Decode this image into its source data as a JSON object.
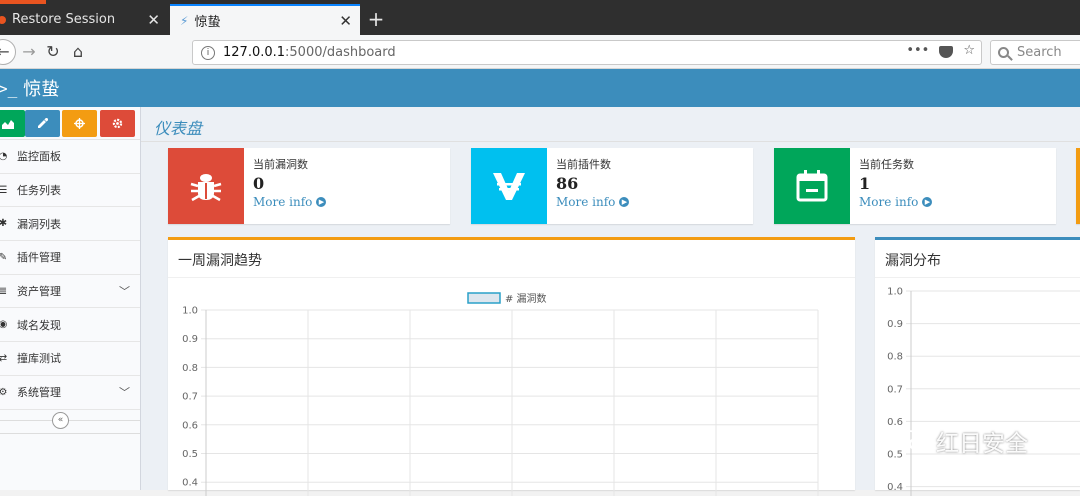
{
  "browser": {
    "tabs": [
      {
        "label": "Restore Session",
        "active": false
      },
      {
        "label": "惊蛰",
        "active": true
      }
    ],
    "url_host": "127.0.0.1",
    "url_path": ":5000/dashboard",
    "search_placeholder": "Search",
    "accent_color": "#0a84ff"
  },
  "app": {
    "title": "惊蛰",
    "header_color": "#3c8dbc"
  },
  "sidebar": {
    "buttons": [
      {
        "icon": "chart-icon",
        "color": "#00a65a"
      },
      {
        "icon": "pencil-icon",
        "color": "#3c8dbc"
      },
      {
        "icon": "crosshair-icon",
        "color": "#f39c12"
      },
      {
        "icon": "gear-icon",
        "color": "#dd4b39"
      }
    ],
    "items": [
      {
        "label": "监控面板",
        "icon": "dashboard-icon"
      },
      {
        "label": "任务列表",
        "icon": "list-icon"
      },
      {
        "label": "漏洞列表",
        "icon": "bug-icon"
      },
      {
        "label": "插件管理",
        "icon": "edit-icon"
      },
      {
        "label": "资产管理",
        "icon": "database-icon",
        "has_submenu": true
      },
      {
        "label": "域名发现",
        "icon": "eye-icon"
      },
      {
        "label": "撞库测试",
        "icon": "shuffle-icon"
      },
      {
        "label": "系统管理",
        "icon": "cogs-icon",
        "has_submenu": true
      }
    ]
  },
  "page": {
    "title": "仪表盘"
  },
  "info_boxes": [
    {
      "label": "当前漏洞数",
      "value": "0",
      "more": "More info",
      "color": "#dd4b39",
      "icon": "bug-icon"
    },
    {
      "label": "当前插件数",
      "value": "86",
      "more": "More info",
      "color": "#00c0ef",
      "icon": "vechain-icon"
    },
    {
      "label": "当前任务数",
      "value": "1",
      "more": "More info",
      "color": "#00a65a",
      "icon": "calendar-icon"
    }
  ],
  "panels": {
    "weekly": {
      "title": "一周漏洞趋势",
      "accent": "#f39c12"
    },
    "distribution": {
      "title": "漏洞分布",
      "accent": "#3c8dbc"
    }
  },
  "chart_data": [
    {
      "type": "line",
      "legend": [
        "# 漏洞数"
      ],
      "ylim": [
        0.4,
        1.0
      ],
      "yticks": [
        1.0,
        0.9,
        0.8,
        0.7,
        0.6,
        0.5,
        0.4
      ],
      "grid": true,
      "legend_position": "top-center"
    },
    {
      "type": "bar",
      "ylim": [
        0.4,
        1.0
      ],
      "yticks": [
        1.0,
        0.9,
        0.8,
        0.7,
        0.6,
        0.5,
        0.4
      ],
      "grid": true
    }
  ],
  "watermark": "红日安全"
}
